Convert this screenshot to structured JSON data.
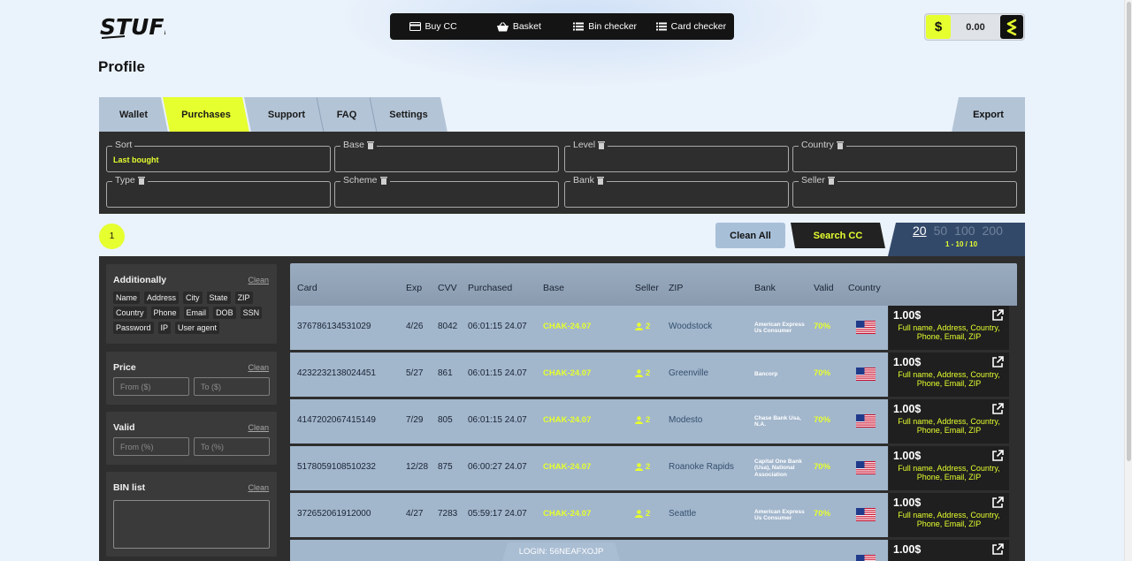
{
  "app": {
    "logo_text": "STUFF"
  },
  "topnav": [
    {
      "label": "Buy CC",
      "icon": "credit-card-icon"
    },
    {
      "label": "Basket",
      "icon": "basket-icon"
    },
    {
      "label": "Bin checker",
      "icon": "list-icon"
    },
    {
      "label": "Card checker",
      "icon": "list-icon"
    }
  ],
  "balance": {
    "currency_symbol": "$",
    "amount": "0.00"
  },
  "page_title": "Profile",
  "tabs": [
    {
      "label": "Wallet",
      "active": false
    },
    {
      "label": "Purchases",
      "active": true
    },
    {
      "label": "Support",
      "active": false
    },
    {
      "label": "FAQ",
      "active": false
    },
    {
      "label": "Settings",
      "active": false
    }
  ],
  "export_label": "Export",
  "filters": [
    {
      "label": "Sort",
      "value": "Last bought",
      "trash": false
    },
    {
      "label": "Base",
      "value": "",
      "trash": true
    },
    {
      "label": "Level",
      "value": "",
      "trash": true
    },
    {
      "label": "Country",
      "value": "",
      "trash": true
    },
    {
      "label": "Type",
      "value": "",
      "trash": true
    },
    {
      "label": "Scheme",
      "value": "",
      "trash": true
    },
    {
      "label": "Bank",
      "value": "",
      "trash": true
    },
    {
      "label": "Seller",
      "value": "",
      "trash": true
    }
  ],
  "pagination": {
    "current_page": "1",
    "per_page_options": [
      "20",
      "50",
      "100",
      "200"
    ],
    "per_page_active": "20",
    "range": "1 - 10 / 10"
  },
  "actions": {
    "clean_all": "Clean All",
    "search": "Search CC"
  },
  "left_filters": {
    "additionally": {
      "title": "Additionally",
      "clean": "Clean",
      "tags": [
        "Name",
        "Address",
        "City",
        "State",
        "ZIP",
        "Country",
        "Phone",
        "Email",
        "DOB",
        "SSN",
        "Password",
        "IP",
        "User agent"
      ]
    },
    "price": {
      "title": "Price",
      "clean": "Clean",
      "from_placeholder": "From ($)",
      "to_placeholder": "To ($)"
    },
    "valid": {
      "title": "Valid",
      "clean": "Clean",
      "from_placeholder": "From (%)",
      "to_placeholder": "To (%)"
    },
    "bin_list": {
      "title": "BIN list",
      "clean": "Clean"
    }
  },
  "table": {
    "columns": [
      "Card",
      "Exp",
      "CVV",
      "Purchased",
      "Base",
      "Seller",
      "ZIP",
      "Bank",
      "Valid",
      "Country"
    ],
    "rows": [
      {
        "card": "376786134531029",
        "exp": "4/26",
        "cvv": "8042",
        "purchased": "06:01:15 24.07",
        "base": "CHAK-24.07",
        "seller": "2",
        "zip": "Woodstock",
        "bank": "American Express Us Consumer",
        "valid": "70%",
        "country_flag": "us-flag-icon",
        "price": "1.00$",
        "details": "Full name, Address, Country, Phone, Email, ZIP"
      },
      {
        "card": "4232232138024451",
        "exp": "5/27",
        "cvv": "861",
        "purchased": "06:01:15 24.07",
        "base": "CHAK-24.07",
        "seller": "2",
        "zip": "Greenville",
        "bank": "Bancorp",
        "valid": "70%",
        "country_flag": "us-flag-icon",
        "price": "1.00$",
        "details": "Full name, Address, Country, Phone, Email, ZIP"
      },
      {
        "card": "4147202067415149",
        "exp": "7/29",
        "cvv": "805",
        "purchased": "06:01:15 24.07",
        "base": "CHAK-24.07",
        "seller": "2",
        "zip": "Modesto",
        "bank": "Chase Bank Usa, N.A.",
        "valid": "70%",
        "country_flag": "us-flag-icon",
        "price": "1.00$",
        "details": "Full name, Address, Country, Phone, Email, ZIP"
      },
      {
        "card": "5178059108510232",
        "exp": "12/28",
        "cvv": "875",
        "purchased": "06:00:27 24.07",
        "base": "CHAK-24.07",
        "seller": "2",
        "zip": "Roanoke Rapids",
        "bank": "Capital One Bank (Usa), National Association",
        "valid": "70%",
        "country_flag": "us-flag-icon",
        "price": "1.00$",
        "details": "Full name, Address, Country, Phone, Email, ZIP"
      },
      {
        "card": "372652061912000",
        "exp": "4/27",
        "cvv": "7283",
        "purchased": "05:59:17 24.07",
        "base": "CHAK-24.07",
        "seller": "2",
        "zip": "Seattle",
        "bank": "American Express Us Consumer",
        "valid": "70%",
        "country_flag": "us-flag-icon",
        "price": "1.00$",
        "details": "Full name, Address, Country, Phone, Email, ZIP"
      },
      {
        "card": "",
        "exp": "",
        "cvv": "",
        "purchased": "",
        "base": "",
        "seller": "",
        "zip": "",
        "bank": "",
        "valid": "",
        "country_flag": "us-flag-icon",
        "price": "1.00$",
        "details": ""
      }
    ]
  },
  "login_badge": "LOGIN: 56NEAFXOJP",
  "colors": {
    "accent": "#e6ff2e",
    "panel": "#2e2e2e",
    "row": "#a2b6cc",
    "header": "#9aacc0",
    "tab": "#b3c4d6"
  }
}
